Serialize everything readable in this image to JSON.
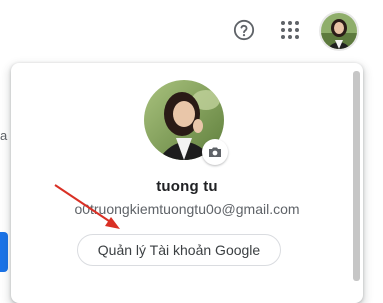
{
  "header": {
    "help_icon": "help-circle-icon",
    "apps_icon": "apps-grid-icon",
    "avatar_icon": "profile-photo"
  },
  "account": {
    "name": "tuong tu",
    "email": "o0truongkiemtuongtu0o@gmail.com",
    "manage_label": "Quản lý Tài khoản Google",
    "camera_icon": "camera-icon"
  },
  "colors": {
    "annotation_arrow": "#d93025",
    "brand_blue": "#1a73e8"
  }
}
